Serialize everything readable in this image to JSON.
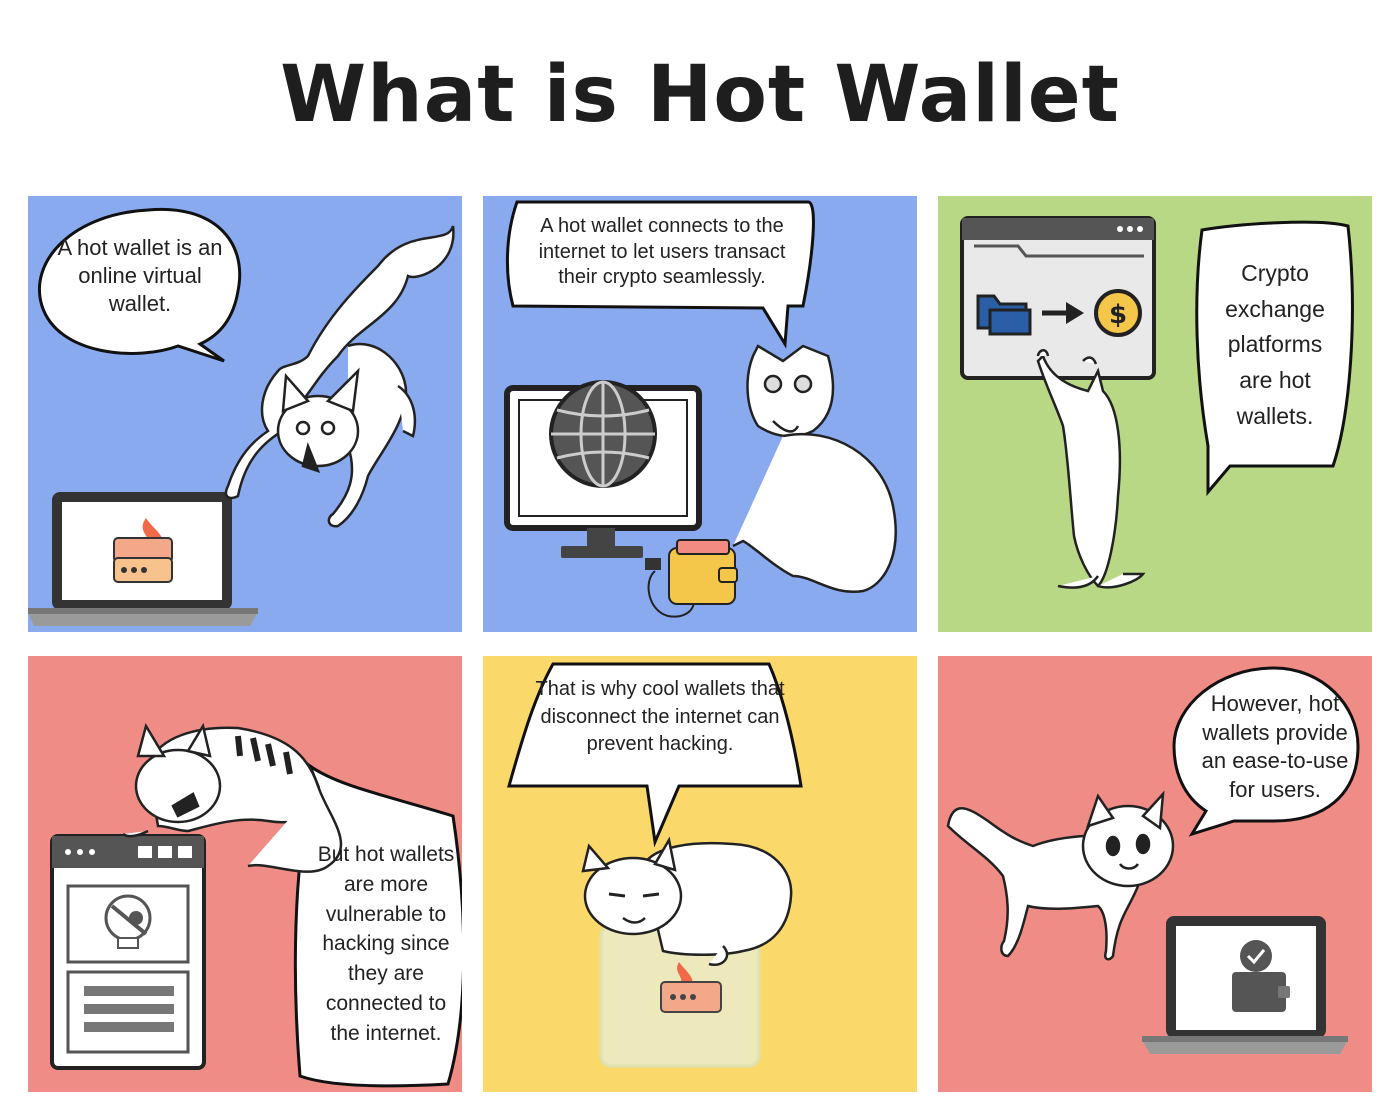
{
  "title": "What is Hot Wallet",
  "colors": {
    "blue": "#8aaaf0",
    "green": "#b9d886",
    "red": "#f08c86",
    "yellow": "#fbd86a"
  },
  "panels": [
    {
      "bg": "blue",
      "text": "A hot wallet is an online virtual wallet.",
      "icons": [
        "cat-icon",
        "laptop-icon",
        "burning-wallet-icon"
      ]
    },
    {
      "bg": "blue",
      "text": "A hot wallet connects to the internet to let users transact their crypto seamlessly.",
      "icons": [
        "cat-icon",
        "monitor-icon",
        "globe-icon",
        "wallet-plug-icon"
      ]
    },
    {
      "bg": "green",
      "text": "Crypto exchange platforms are hot wallets.",
      "icons": [
        "browser-window-icon",
        "folder-icon",
        "arrow-right-icon",
        "dollar-coin-icon",
        "cat-icon"
      ]
    },
    {
      "bg": "red",
      "text": "But hot wallets are more vulnerable to hacking since they are connected to the internet.",
      "icons": [
        "cat-icon",
        "browser-window-icon",
        "pirate-skull-icon"
      ]
    },
    {
      "bg": "yellow",
      "text": "That is why cool wallets that disconnect the internet can prevent hacking.",
      "icons": [
        "cat-icon",
        "ice-cube-icon",
        "wallet-icon"
      ]
    },
    {
      "bg": "red",
      "text": "However, hot wallets provide an ease-to-use for users.",
      "icons": [
        "cat-icon",
        "laptop-icon",
        "checkmark-wallet-icon"
      ]
    }
  ]
}
